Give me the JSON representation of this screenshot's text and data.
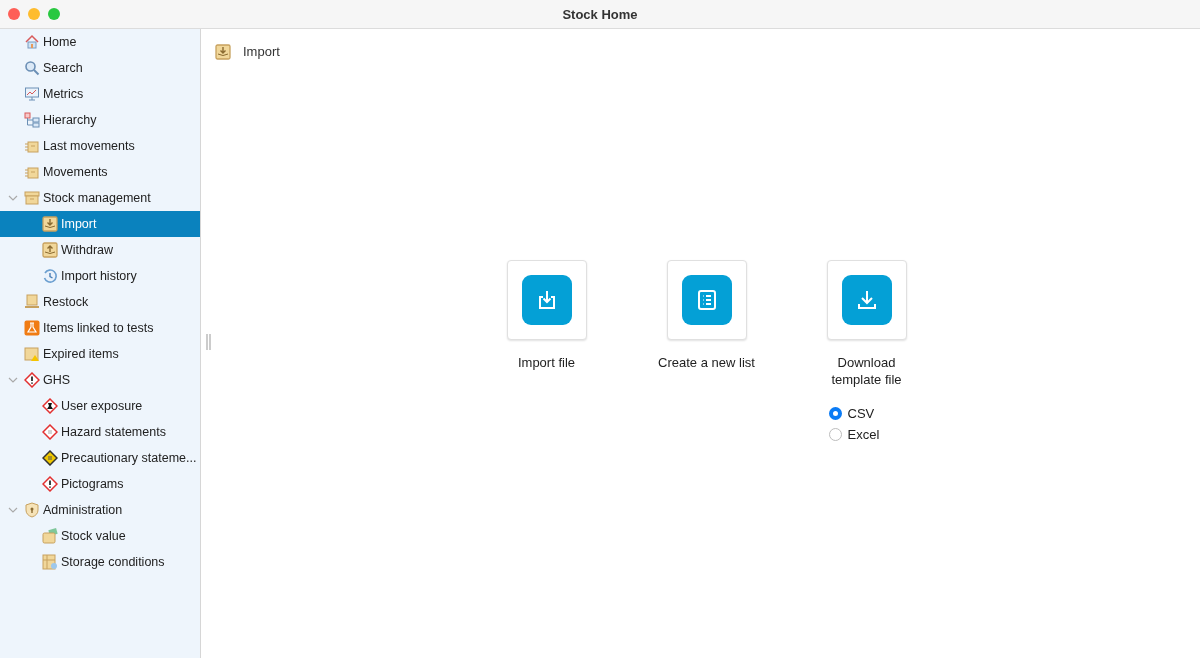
{
  "window": {
    "title": "Stock Home"
  },
  "sidebar": {
    "items": [
      {
        "label": "Home",
        "selected": false
      },
      {
        "label": "Search",
        "selected": false
      },
      {
        "label": "Metrics",
        "selected": false
      },
      {
        "label": "Hierarchy",
        "selected": false
      },
      {
        "label": "Last movements",
        "selected": false
      },
      {
        "label": "Movements",
        "selected": false
      },
      {
        "label": "Stock management",
        "selected": false,
        "expanded": true,
        "children": [
          {
            "label": "Import",
            "selected": true
          },
          {
            "label": "Withdraw",
            "selected": false
          },
          {
            "label": "Import history",
            "selected": false
          }
        ]
      },
      {
        "label": "Restock",
        "selected": false
      },
      {
        "label": "Items linked to tests",
        "selected": false
      },
      {
        "label": "Expired items",
        "selected": false
      },
      {
        "label": "GHS",
        "selected": false,
        "expanded": true,
        "children": [
          {
            "label": "User exposure",
            "selected": false
          },
          {
            "label": "Hazard statements",
            "selected": false
          },
          {
            "label": "Precautionary stateme...",
            "selected": false
          },
          {
            "label": "Pictograms",
            "selected": false
          }
        ]
      },
      {
        "label": "Administration",
        "selected": false,
        "expanded": true,
        "children": [
          {
            "label": "Stock value",
            "selected": false
          },
          {
            "label": "Storage conditions",
            "selected": false
          }
        ]
      }
    ]
  },
  "content": {
    "title": "Import",
    "actions": [
      {
        "kind": "import",
        "label": "Import file"
      },
      {
        "kind": "list",
        "label": "Create a new list"
      },
      {
        "kind": "download",
        "label": "Download template file",
        "options": [
          {
            "label": "CSV",
            "selected": true
          },
          {
            "label": "Excel",
            "selected": false
          }
        ]
      }
    ]
  }
}
